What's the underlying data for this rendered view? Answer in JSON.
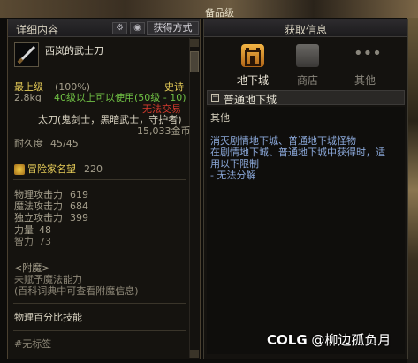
{
  "background": {
    "top_label": "备品级"
  },
  "left_panel": {
    "title": "详细内容",
    "mode_button": "获得方式",
    "item_name": "西岚的武士刀",
    "grade": "最上级",
    "grade_pct": "(100%)",
    "rarity": "史诗",
    "weight": "2.8kg",
    "level_req": "40级以上可以使用(50级 - 10)",
    "trade": "无法交易",
    "item_type": "太刀(鬼剑士，黑暗武士，守护者)",
    "price": "15,033金币",
    "durability_label": "耐久度",
    "durability_value": "45/45",
    "reputation_label": "冒险家名望",
    "reputation_value": "220",
    "stats": [
      {
        "label": "物理攻击力",
        "value": "619"
      },
      {
        "label": "魔法攻击力",
        "value": "684"
      },
      {
        "label": "独立攻击力",
        "value": "399"
      },
      {
        "label": "力量",
        "value": "48"
      },
      {
        "label": "智力",
        "value": "73"
      }
    ],
    "enchant_title": "<附魔>",
    "enchant_line1": "未赋予魔法能力",
    "enchant_line2": "(百科词典中可查看附魔信息)",
    "skill_title": "物理百分比技能",
    "tag": "#无标签"
  },
  "right_panel": {
    "title": "获取信息",
    "tabs": [
      "地下城",
      "商店",
      "其他"
    ],
    "section_title": "普通地下城",
    "lines": [
      "其他",
      "消灭剧情地下城、普通地下城怪物",
      "在剧情地下城、普通地下城中获得时，适",
      "用以下限制",
      "- 无法分解"
    ]
  },
  "watermark": {
    "logo": "COLG",
    "text": "@柳边孤负月"
  },
  "colors": {
    "gold": "#e6cc58",
    "green": "#6fbf44",
    "red": "#d63a2e",
    "accent": "#f3b544"
  }
}
